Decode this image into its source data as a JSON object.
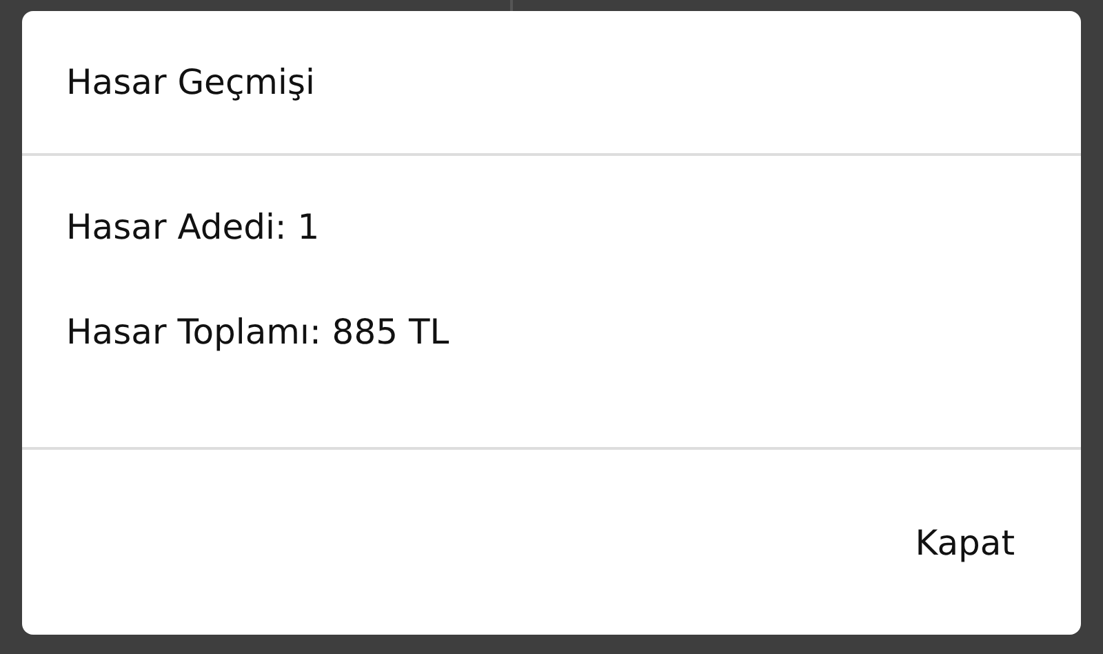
{
  "dialog": {
    "title": "Hasar Geçmişi",
    "lines": [
      "Hasar Adedi: 1",
      "Hasar Toplamı: 885 TL"
    ],
    "buttons": [
      "Kapat"
    ]
  }
}
